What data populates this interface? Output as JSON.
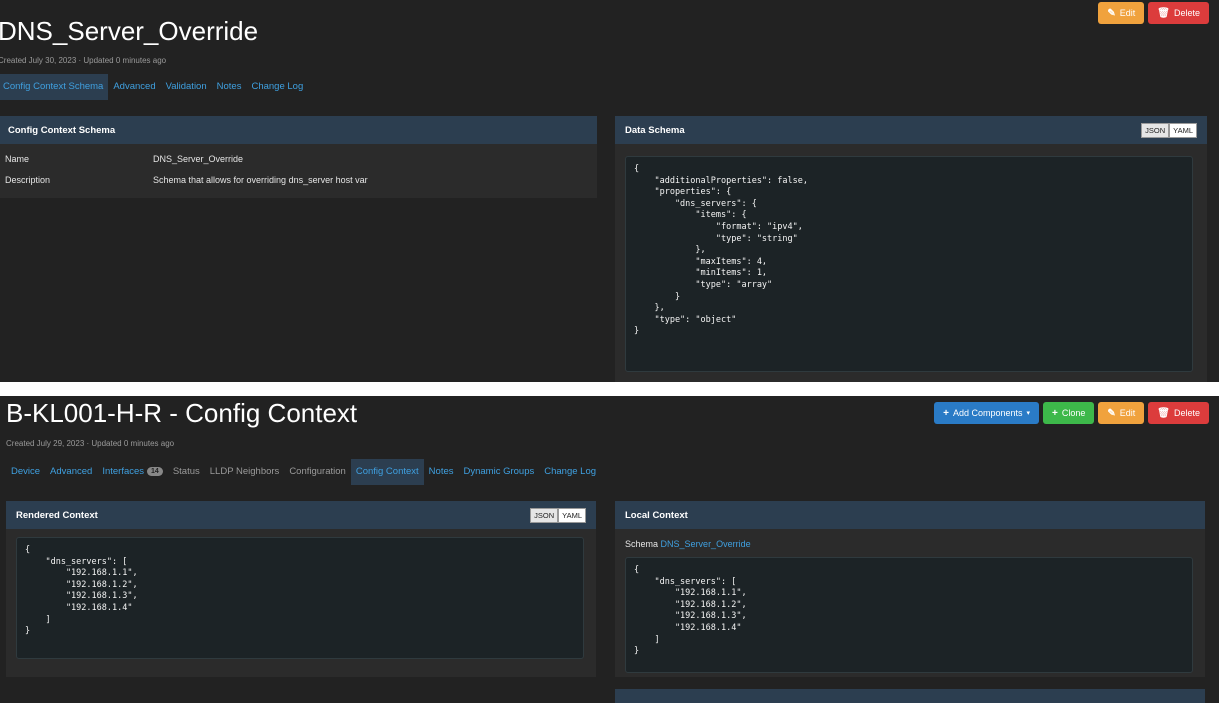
{
  "schema_page": {
    "title": "DNS_Server_Override",
    "meta": "Created July 30, 2023 · Updated 0 minutes ago",
    "buttons": {
      "edit": "Edit",
      "delete": "Delete"
    },
    "tabs": [
      "Config Context Schema",
      "Advanced",
      "Validation",
      "Notes",
      "Change Log"
    ],
    "left_panel": {
      "title": "Config Context Schema",
      "rows": [
        {
          "key": "Name",
          "value": "DNS_Server_Override"
        },
        {
          "key": "Description",
          "value": "Schema that allows for overriding dns_server host var"
        }
      ]
    },
    "right_panel": {
      "title": "Data Schema",
      "toggle": {
        "json": "JSON",
        "yaml": "YAML"
      },
      "code": "{\n    \"additionalProperties\": false,\n    \"properties\": {\n        \"dns_servers\": {\n            \"items\": {\n                \"format\": \"ipv4\",\n                \"type\": \"string\"\n            },\n            \"maxItems\": 4,\n            \"minItems\": 1,\n            \"type\": \"array\"\n        }\n    },\n    \"type\": \"object\"\n}"
    }
  },
  "device_page": {
    "title": "B-KL001-H-R - Config Context",
    "meta": "Created July 29, 2023 · Updated 0 minutes ago",
    "buttons": {
      "add_components": "Add Components",
      "clone": "Clone",
      "edit": "Edit",
      "delete": "Delete"
    },
    "tabs": [
      {
        "label": "Device"
      },
      {
        "label": "Advanced"
      },
      {
        "label": "Interfaces",
        "badge": "14"
      },
      {
        "label": "Status"
      },
      {
        "label": "LLDP Neighbors"
      },
      {
        "label": "Configuration"
      },
      {
        "label": "Config Context"
      },
      {
        "label": "Notes"
      },
      {
        "label": "Dynamic Groups"
      },
      {
        "label": "Change Log"
      }
    ],
    "rendered_panel": {
      "title": "Rendered Context",
      "toggle": {
        "json": "JSON",
        "yaml": "YAML"
      },
      "code": "{\n    \"dns_servers\": [\n        \"192.168.1.1\",\n        \"192.168.1.2\",\n        \"192.168.1.3\",\n        \"192.168.1.4\"\n    ]\n}"
    },
    "local_panel": {
      "title": "Local Context",
      "schema_label": "Schema",
      "schema_link": "DNS_Server_Override",
      "code": "{\n    \"dns_servers\": [\n        \"192.168.1.1\",\n        \"192.168.1.2\",\n        \"192.168.1.3\",\n        \"192.168.1.4\"\n    ]\n}"
    }
  },
  "colors": {
    "background": "#222222",
    "panel_header": "#2c3e50",
    "link": "#3fa0e0",
    "primary": "#2a7bc6",
    "success": "#3db84a",
    "warning": "#f0a23d",
    "danger": "#dc3c3c"
  },
  "icons": {
    "edit": "pencil-icon",
    "delete": "trash-icon",
    "add": "plus-icon",
    "dropdown": "caret-down-icon"
  }
}
